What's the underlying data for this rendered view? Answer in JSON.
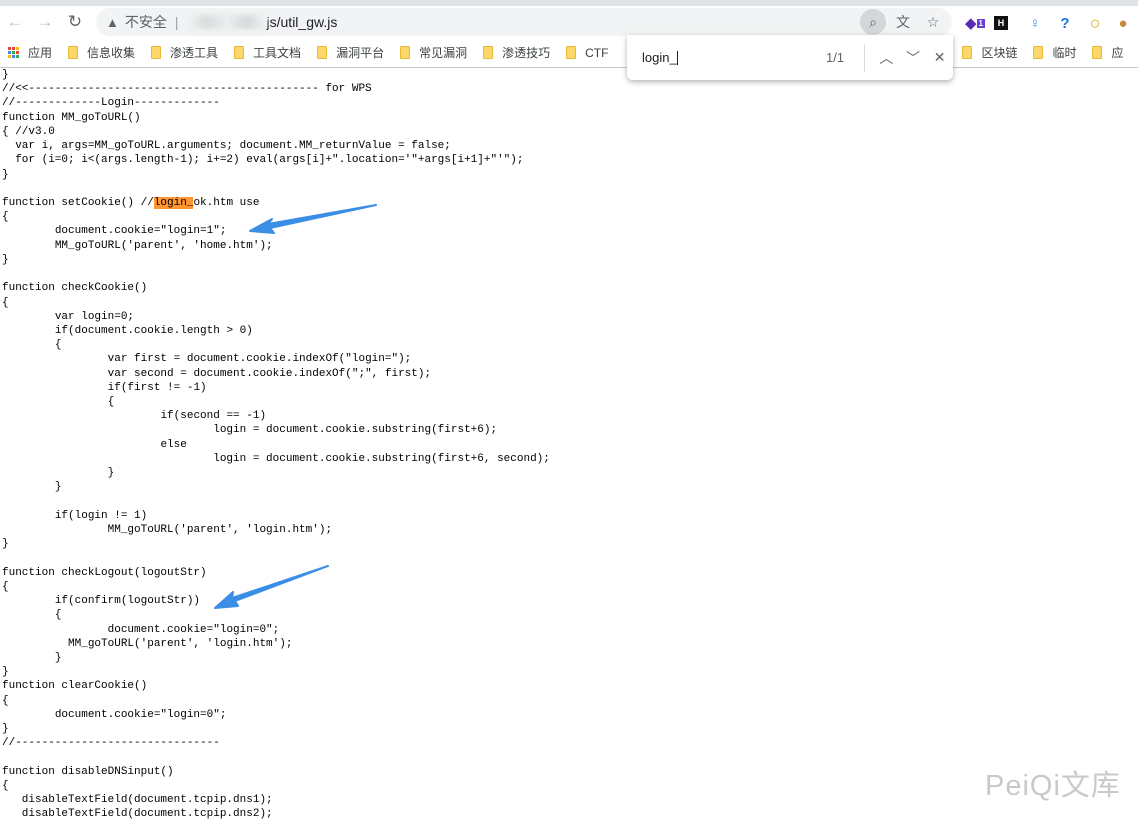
{
  "browser": {
    "security_label": "不安全",
    "url_visible": "js/util_gw.js",
    "bookmarks": [
      "应用",
      "信息收集",
      "渗透工具",
      "工具文档",
      "漏洞平台",
      "常见漏洞",
      "渗透技巧",
      "CTF",
      "区块链",
      "临时",
      "应"
    ],
    "extension_badge": "1"
  },
  "find_bar": {
    "query": "login_",
    "count": "1/1"
  },
  "code_lines": [
    "}",
    "//<<-------------------------------------------- for WPS",
    "//-------------Login-------------",
    "function MM_goToURL()",
    "{ //v3.0",
    "  var i, args=MM_goToURL.arguments; document.MM_returnValue = false;",
    "  for (i=0; i<(args.length-1); i+=2) eval(args[i]+\".location='\"+args[i+1]+\"'\");",
    "}",
    "",
    "function setCookie() //login_ok.htm use",
    "{",
    "\tdocument.cookie=\"login=1\";",
    "\tMM_goToURL('parent', 'home.htm');",
    "}",
    "",
    "function checkCookie()",
    "{",
    "\tvar login=0;",
    "\tif(document.cookie.length > 0)",
    "\t{",
    "\t\tvar first = document.cookie.indexOf(\"login=\");",
    "\t\tvar second = document.cookie.indexOf(\";\", first);",
    "\t\tif(first != -1)",
    "\t\t{",
    "\t\t\tif(second == -1)",
    "\t\t\t\tlogin = document.cookie.substring(first+6);",
    "\t\t\telse",
    "\t\t\t\tlogin = document.cookie.substring(first+6, second);",
    "\t\t}",
    "\t}",
    "",
    "\tif(login != 1)",
    "\t\tMM_goToURL('parent', 'login.htm');",
    "}",
    "",
    "function checkLogout(logoutStr)",
    "{",
    "\tif(confirm(logoutStr))",
    "\t{",
    "\t\tdocument.cookie=\"login=0\";",
    "\t  MM_goToURL('parent', 'login.htm');",
    "\t}",
    "}",
    "function clearCookie()",
    "{",
    "\tdocument.cookie=\"login=0\";",
    "}",
    "//-------------------------------",
    "",
    "function disableDNSinput()",
    "{",
    "   disableTextField(document.tcpip.dns1);",
    "   disableTextField(document.tcpip.dns2);"
  ],
  "watermark": "PeiQi文库",
  "colors": {
    "highlight": "#ff9632",
    "arrow": "#3a8ee6"
  }
}
